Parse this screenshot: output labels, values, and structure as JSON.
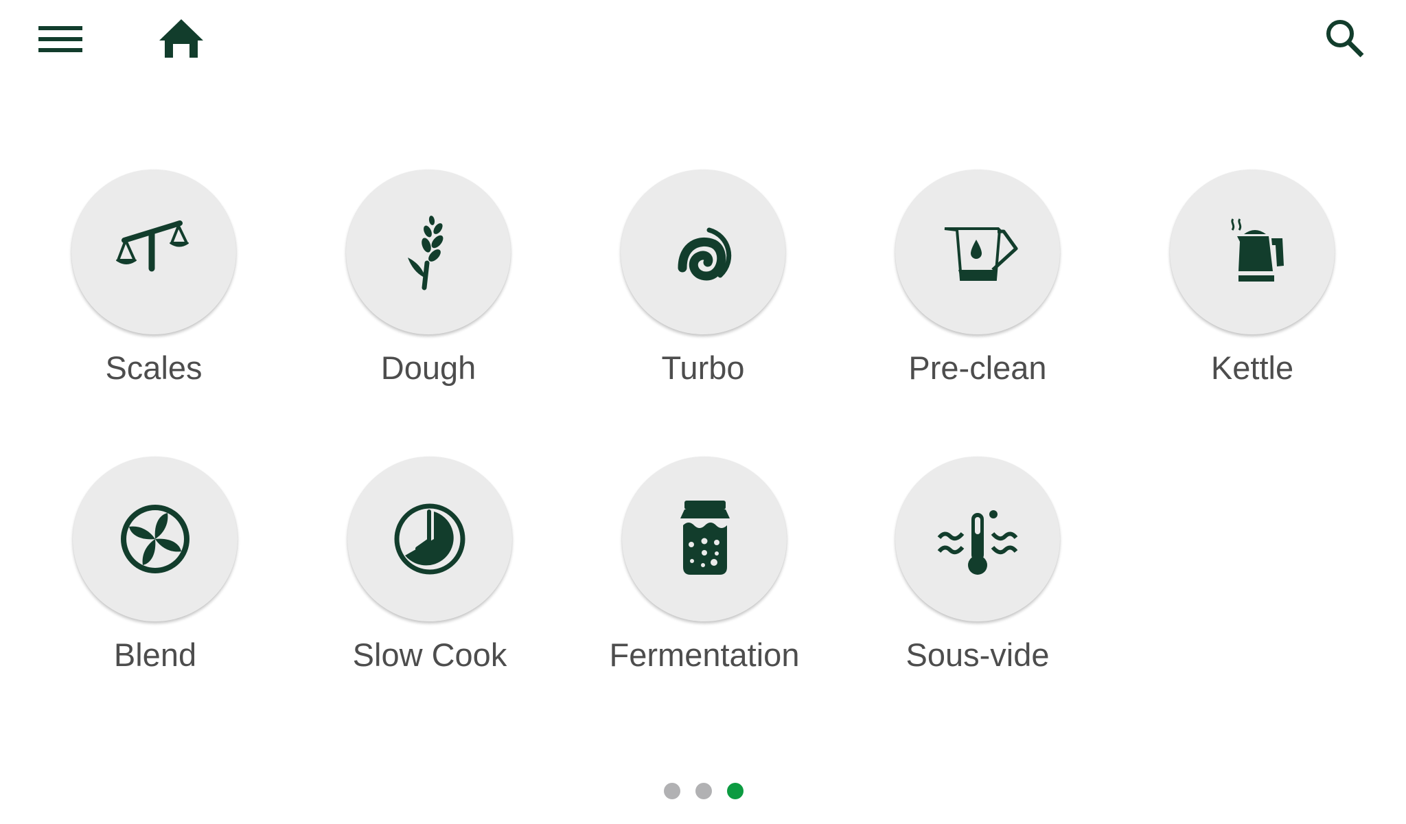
{
  "header": {
    "menu_icon": "hamburger-menu-icon",
    "home_icon": "home-icon",
    "search_icon": "search-icon"
  },
  "colors": {
    "icon_green": "#123d2c",
    "tile_bg": "#ebebeb",
    "label_text": "#4d4d4d",
    "dot_inactive": "#b1b1b3",
    "dot_active": "#0c9b41"
  },
  "modes": [
    {
      "label": "Scales",
      "icon": "scales-icon"
    },
    {
      "label": "Dough",
      "icon": "wheat-icon"
    },
    {
      "label": "Turbo",
      "icon": "swirl-icon"
    },
    {
      "label": "Pre-clean",
      "icon": "jug-droplet-icon"
    },
    {
      "label": "Kettle",
      "icon": "kettle-icon"
    },
    {
      "label": "Blend",
      "icon": "blade-icon"
    },
    {
      "label": "Slow Cook",
      "icon": "clock-icon"
    },
    {
      "label": "Fermentation",
      "icon": "jar-icon"
    },
    {
      "label": "Sous-vide",
      "icon": "thermometer-water-icon"
    }
  ],
  "pagination": {
    "total_pages": 3,
    "current_page": 3
  }
}
